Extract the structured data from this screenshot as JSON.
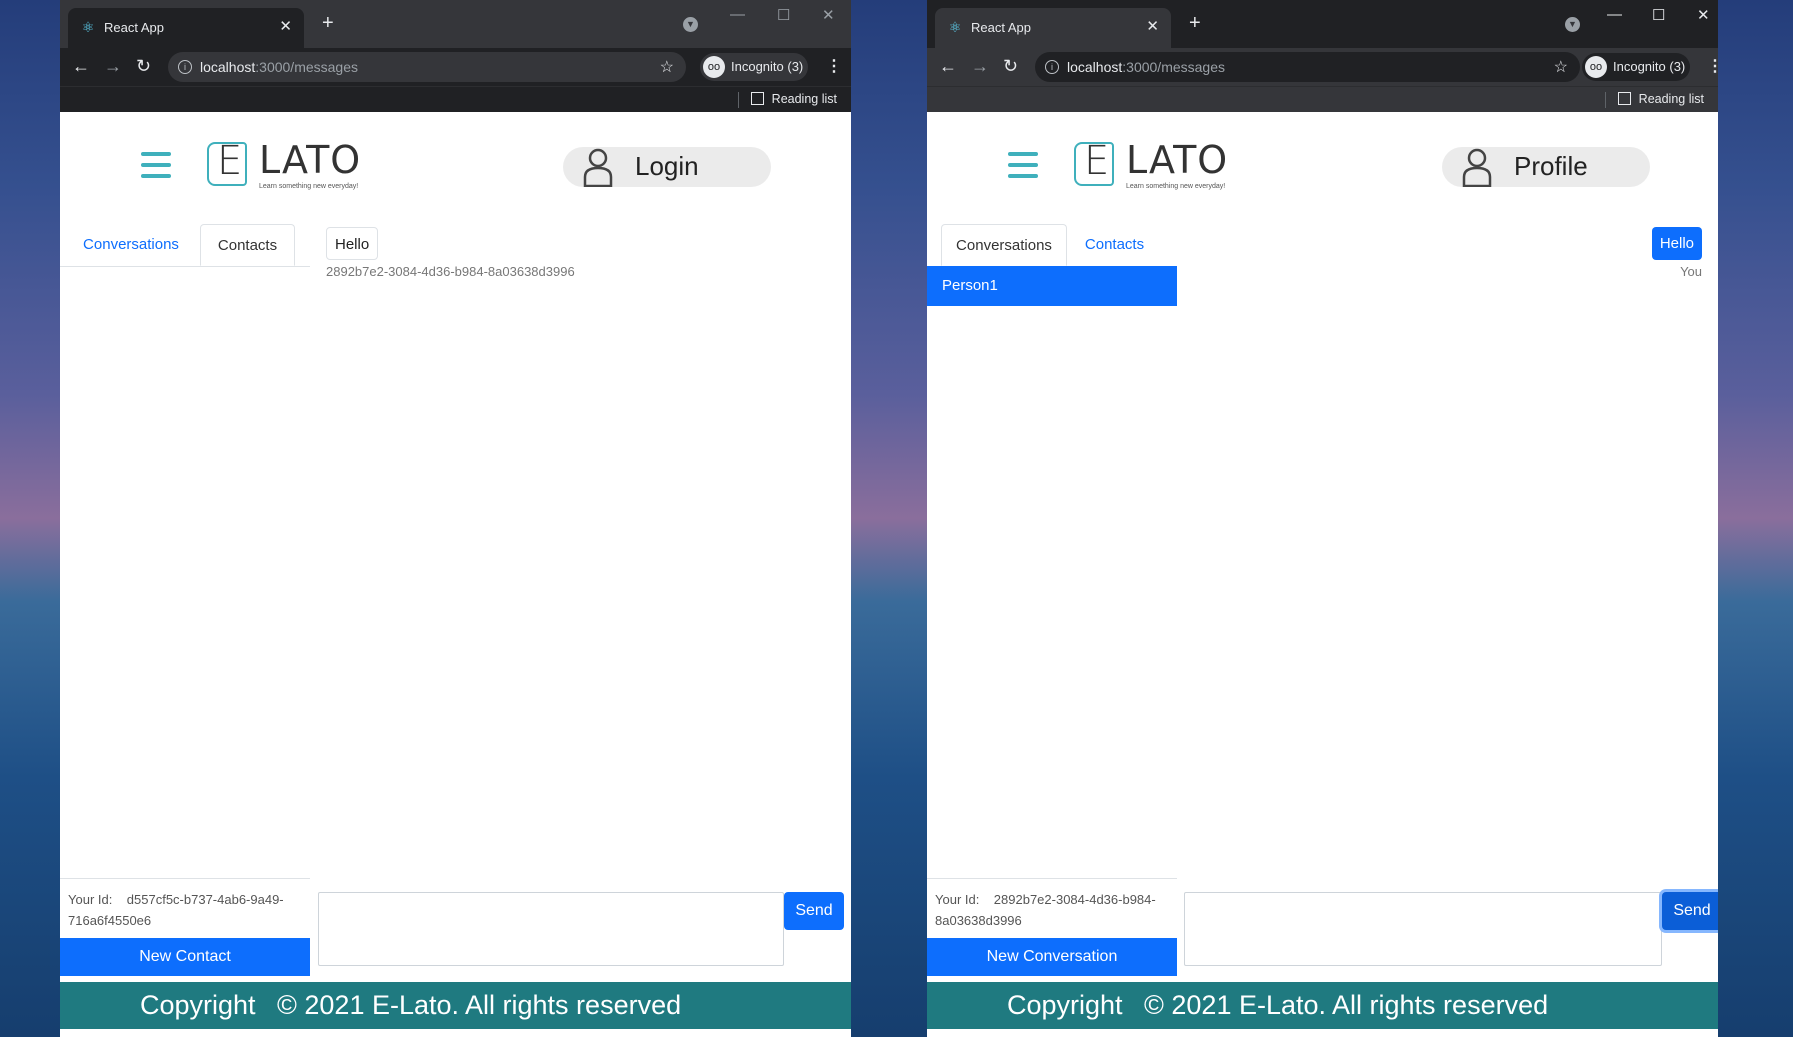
{
  "colors": {
    "primary": "#0d6efd",
    "footer": "#1f7a80",
    "accent": "#3fb0bc"
  },
  "windows": [
    {
      "tab_title": "React App",
      "url_host": "localhost",
      "url_rest": ":3000/messages",
      "incognito": "Incognito (3)",
      "reading_list": "Reading list",
      "user_button": "Login",
      "tabs": [
        "Conversations",
        "Contacts"
      ],
      "message": {
        "text": "Hello",
        "meta": "2892b7e2-3084-4d36-b984-8a03638d3996"
      },
      "your_id_label": "Your Id:",
      "your_id_value": "d557cf5c-b737-4ab6-9a49-716a6f4550e6",
      "new_button": "New Contact",
      "send": "Send",
      "footer_copy": "Copyright",
      "footer_rest": "© 2021 E-Lato. All rights reserved"
    },
    {
      "tab_title": "React App",
      "url_host": "localhost",
      "url_rest": ":3000/messages",
      "incognito": "Incognito (3)",
      "reading_list": "Reading list",
      "user_button": "Profile",
      "tabs": [
        "Conversations",
        "Contacts"
      ],
      "conversation_item": "Person1",
      "message": {
        "text": "Hello",
        "meta": "You"
      },
      "your_id_label": "Your Id:",
      "your_id_value": "2892b7e2-3084-4d36-b984-8a03638d3996",
      "new_button": "New Conversation",
      "send": "Send",
      "footer_copy": "Copyright",
      "footer_rest": "© 2021 E-Lato. All rights reserved"
    }
  ],
  "logo": {
    "letter": "E",
    "text": "LATO",
    "tagline": "Learn something new everyday!"
  },
  "icons": [
    "react-icon",
    "close-icon",
    "plus-icon",
    "tab-search-icon",
    "back-icon",
    "forward-icon",
    "reload-icon",
    "info-icon",
    "star-icon",
    "incognito-icon",
    "menu-icon",
    "reading-list-icon",
    "hamburger-icon",
    "user-icon"
  ]
}
